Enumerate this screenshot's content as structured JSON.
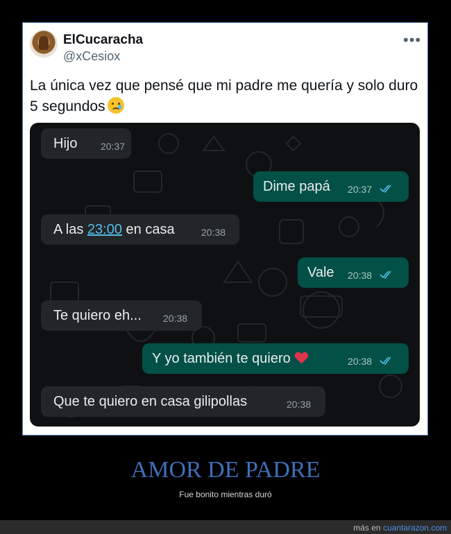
{
  "tweet": {
    "display_name": "ElCucaracha",
    "handle": "@xCesiox",
    "more_icon": "•••",
    "text": "La única vez que pensé que mi padre me quería y solo duro 5 segundos",
    "emoji": "crying-face-emoji"
  },
  "chat": {
    "messages": [
      {
        "direction": "in",
        "text": "Hijo",
        "time": "20:37"
      },
      {
        "direction": "out",
        "text": "Dime papá",
        "time": "20:37",
        "read": true
      },
      {
        "direction": "in",
        "text_before": "A las ",
        "link": "23:00",
        "text_after": " en casa",
        "time": "20:38"
      },
      {
        "direction": "out",
        "text": "Vale",
        "time": "20:38",
        "read": true
      },
      {
        "direction": "in",
        "text": "Te quiero eh...",
        "time": "20:38"
      },
      {
        "direction": "out",
        "text": "Y yo también te quiero",
        "emoji": "red-heart-emoji",
        "time": "20:38",
        "read": true
      },
      {
        "direction": "in",
        "text": "Que te quiero en casa gilipollas",
        "time": "20:38"
      }
    ]
  },
  "caption": {
    "title": "AMOR DE PADRE",
    "subtitle": "Fue bonito mientras duró"
  },
  "footer": {
    "prefix": "más en ",
    "site": "cuantarazon.com"
  },
  "colors": {
    "title_blue": "#3f6fb8",
    "incoming_bubble": "#232628",
    "outgoing_bubble": "#035046",
    "read_ticks": "#53bdeb",
    "link": "#53bdeb"
  }
}
